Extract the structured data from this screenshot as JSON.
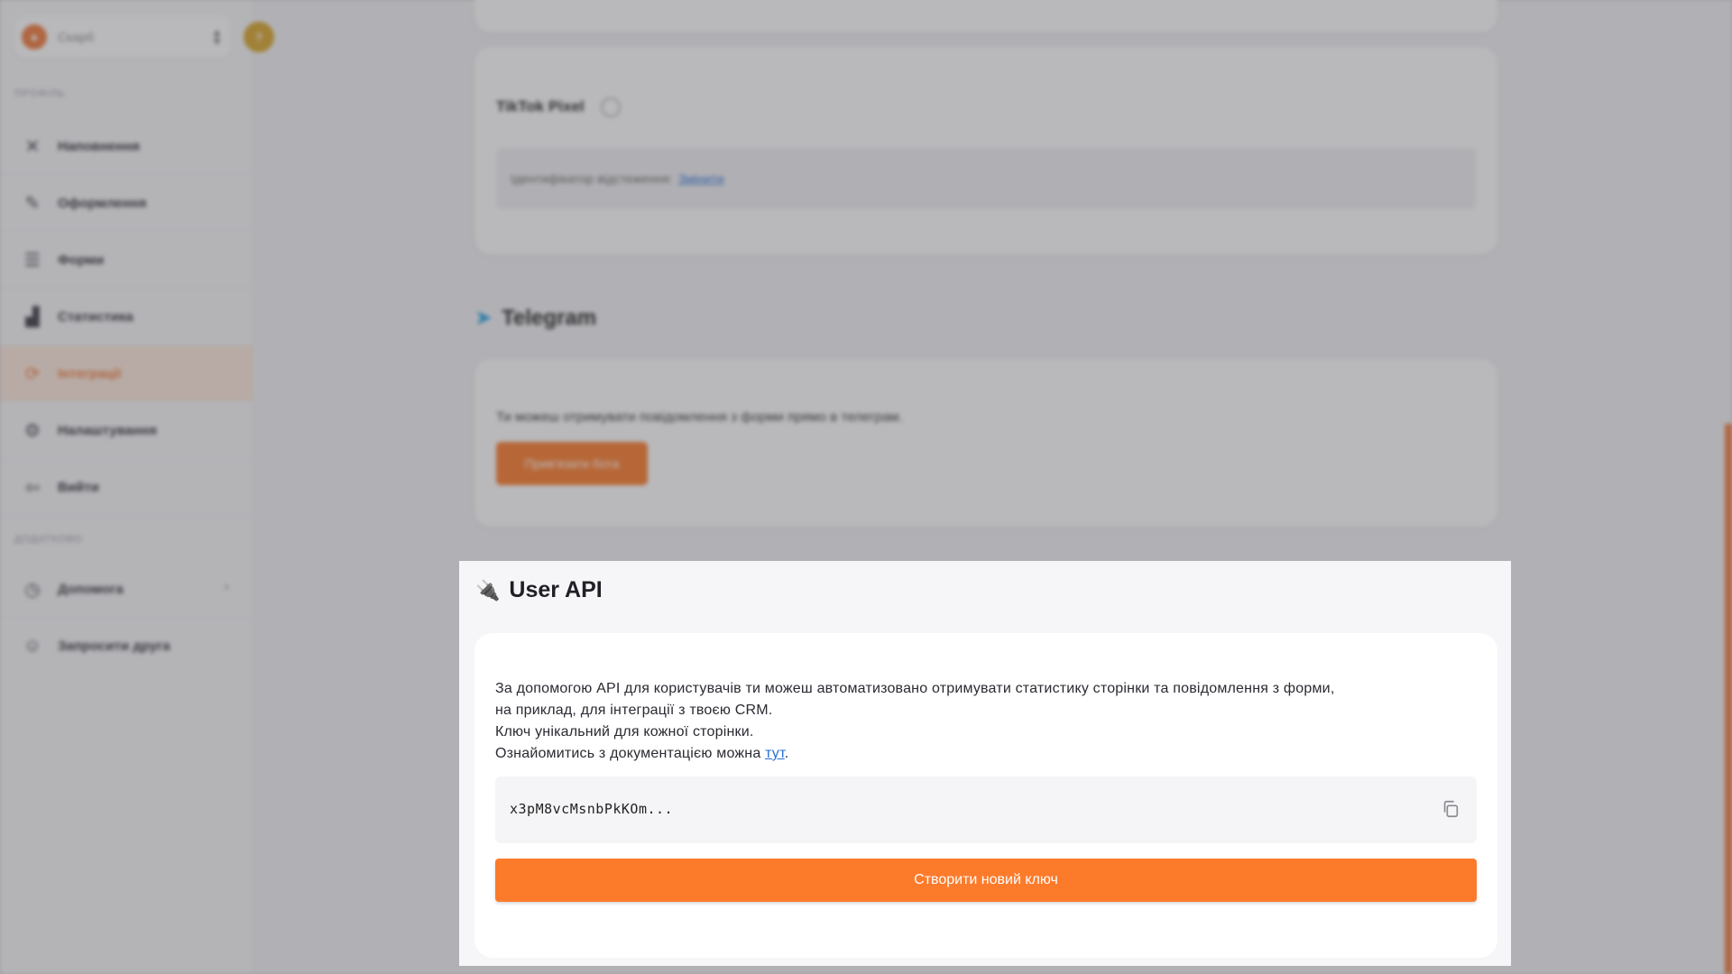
{
  "sidebar": {
    "page_name": "Скарб",
    "avatar_initial": "?",
    "section_profile": "Профіль",
    "section_extra": "Додатково",
    "items": [
      {
        "label": "Наповнення",
        "icon": "tools-icon"
      },
      {
        "label": "Оформлення",
        "icon": "brush-icon"
      },
      {
        "label": "Форми",
        "icon": "list-icon"
      },
      {
        "label": "Статистика",
        "icon": "chart-icon"
      },
      {
        "label": "Інтеграції",
        "icon": "integration-icon"
      },
      {
        "label": "Налаштування",
        "icon": "gear-icon"
      },
      {
        "label": "Вийти",
        "icon": "logout-icon"
      }
    ],
    "extra_items": [
      {
        "label": "Допомога",
        "icon": "help-icon"
      },
      {
        "label": "Запросити друга",
        "icon": "invite-icon"
      }
    ]
  },
  "tiktok": {
    "title": "TikTok Pixel",
    "field_label": "Ідентифікатор відстеження:",
    "field_link": "Змінити"
  },
  "telegram": {
    "title": "Telegram",
    "description": "Ти можеш отримувати повідомлення з форми прямо в телеграм.",
    "button": "Прив'язати бота"
  },
  "user_api": {
    "title": "User API",
    "desc_line1": "За допомогою API для користувачів ти можеш автоматизовано отримувати статистику сторінки та повідомлення з форми,",
    "desc_line2": "на приклад, для інтеграції з твоєю CRM.",
    "desc_line3": "Ключ унікальний для кожної сторінки.",
    "desc_line4_prefix": "Ознайомитись з документацією можна ",
    "desc_line4_link": "тут",
    "desc_line4_suffix": ".",
    "api_key": "x3pM8vcMsnbPkKOm...",
    "create_button": "Створити новий ключ"
  },
  "colors": {
    "accent": "#fc7b2b",
    "link": "#2a6fd6"
  }
}
